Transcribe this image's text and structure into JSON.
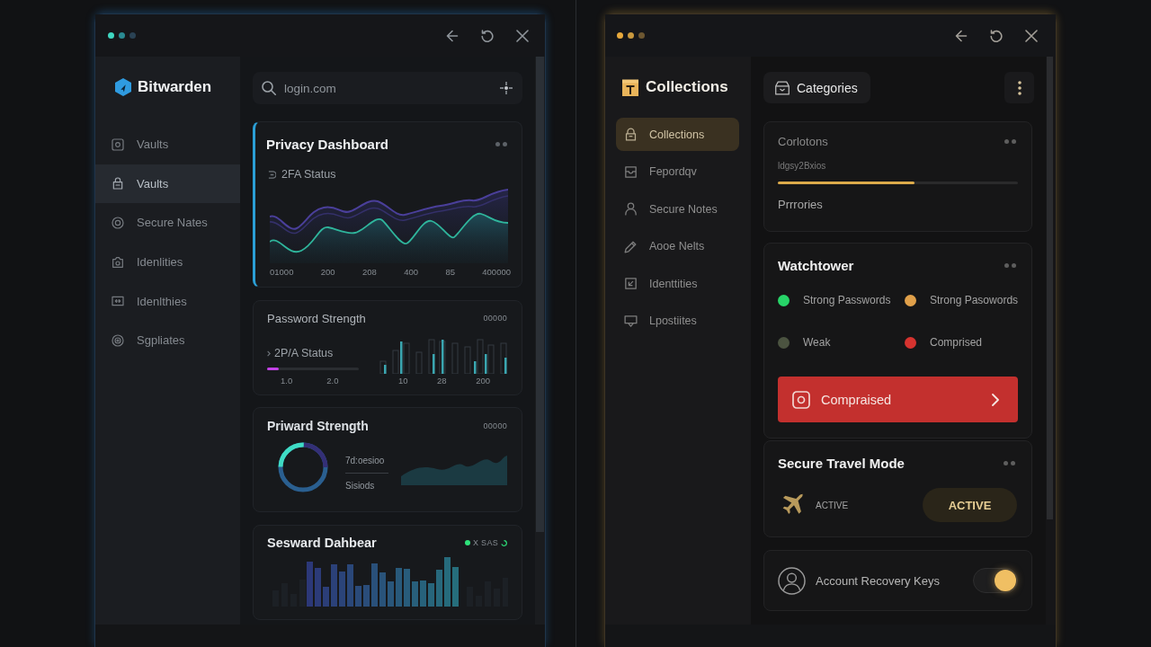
{
  "left": {
    "sidebar": {
      "brand": "Bitwarden",
      "items": [
        {
          "label": "Vaults",
          "selected": false
        },
        {
          "label": "Vaults",
          "selected": true
        },
        {
          "label": "Secure Nates",
          "selected": false
        },
        {
          "label": "Idenlities",
          "selected": false
        },
        {
          "label": "Idenlthies",
          "selected": false
        },
        {
          "label": "Sgpliates",
          "selected": false
        }
      ]
    },
    "search": {
      "value": "login.com"
    },
    "cards": [
      {
        "kind": "area",
        "title": "Privacy Dashboard",
        "selected": true,
        "subtitle": "2FA Status",
        "axis_labels": [
          "01000",
          "200",
          "208",
          "400",
          "85",
          "400000"
        ]
      },
      {
        "kind": "strength",
        "title": "Password Strength",
        "selected": false,
        "corner_text": "00000",
        "status": "2P/A Status",
        "level": 0.13,
        "scale_labels": [
          "1.0",
          "2.0"
        ],
        "bar_labels": [
          "10",
          "28",
          "200"
        ]
      },
      {
        "kind": "donut",
        "title": "Priward Strength",
        "selected": false,
        "corner_text": "00000",
        "lines": [
          "7d:oesioo",
          "Sisiods"
        ]
      },
      {
        "kind": "bars",
        "title": "Sesward Dahbear",
        "selected": false,
        "indicator": "X SAS"
      }
    ]
  },
  "right": {
    "sidebar": {
      "brand": "Collections",
      "items": [
        {
          "label": "Collections",
          "selected": true
        },
        {
          "label": "Fepordqv",
          "selected": false
        },
        {
          "label": "Secure Notes",
          "selected": false
        },
        {
          "label": "Aooe Nelts",
          "selected": false
        },
        {
          "label": "Identtities",
          "selected": false
        },
        {
          "label": "Lpostiites",
          "selected": false
        }
      ]
    },
    "category_button": "Categories",
    "summary": {
      "title": "Corlotons",
      "caption": "ldgsy2Bxios",
      "level": 0.57,
      "footer": "Prrrories"
    },
    "watchtower": {
      "title": "Watchtower",
      "legend": [
        {
          "label": "Strong Passwords",
          "color": "#27d468"
        },
        {
          "label": "Strong Pasowords",
          "color": "#e0a04a"
        },
        {
          "label": "Weak",
          "color": "#4b5340"
        },
        {
          "label": "Comprised",
          "color": "#d6332f"
        }
      ],
      "alert_button": "Compraised"
    },
    "travel_mode": {
      "title": "Secure Travel Mode",
      "status": "ACTIVE",
      "button": "ACTIVE"
    },
    "recovery": {
      "label": "Account Recovery Keys",
      "on": true
    }
  }
}
